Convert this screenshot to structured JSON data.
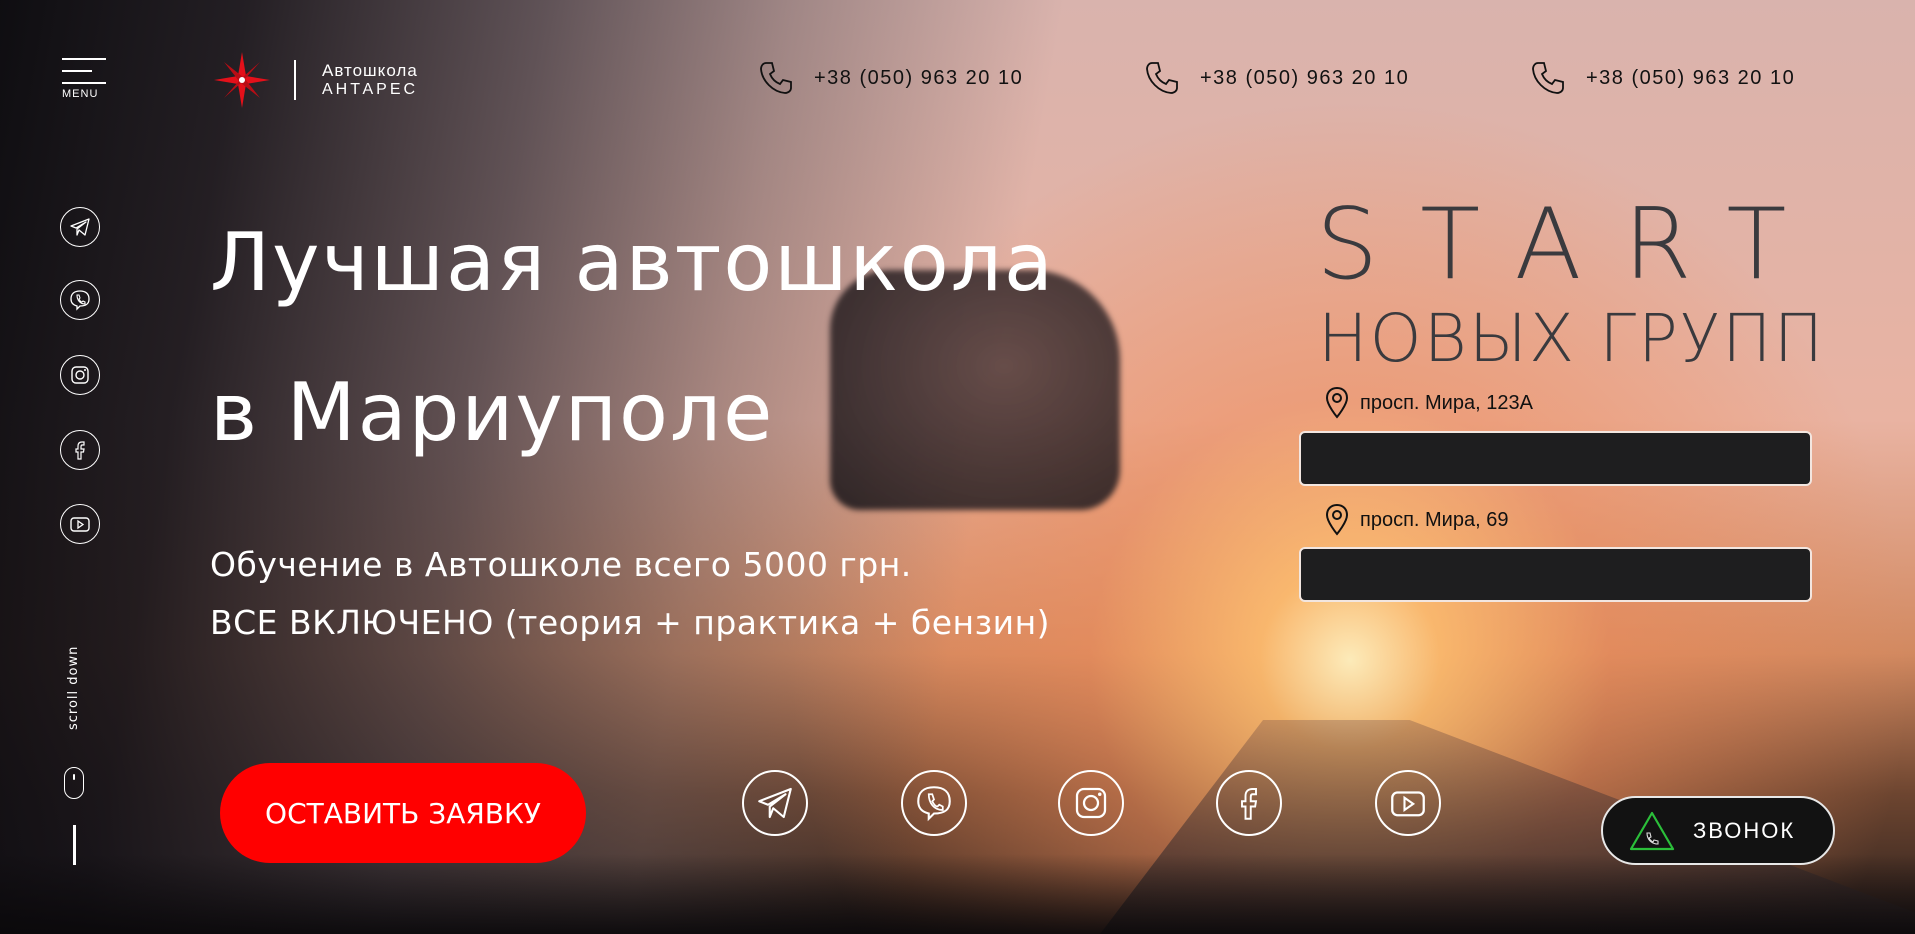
{
  "header": {
    "menu_label": "MENU",
    "logo_line1": "Автошкола",
    "logo_line2": "АНТАРЕС",
    "phones": [
      "+38 (050) 963 20 10",
      "+38 (050) 963 20 10",
      "+38 (050) 963 20 10"
    ]
  },
  "sidebar": {
    "icons": [
      "telegram-icon",
      "viber-icon",
      "instagram-icon",
      "facebook-icon",
      "youtube-icon"
    ],
    "scroll_label": "scroll down"
  },
  "hero": {
    "title_line1": "Лучшая автошкола",
    "title_line2": "в Мариуполе",
    "subtitle_line1": "Обучение в Автошколе всего 5000 грн.",
    "subtitle_line2": "ВСЕ ВКЛЮЧЕНО (теория + практика + бензин)",
    "cta_label": "ОСТАВИТЬ ЗАЯВКУ"
  },
  "promo": {
    "title": "START",
    "subtitle": "НОВЫХ ГРУПП",
    "addresses": [
      "просп. Мира, 123А",
      "просп. Мира, 69"
    ]
  },
  "bottom_social": [
    "telegram-icon",
    "viber-icon",
    "instagram-icon",
    "facebook-icon",
    "youtube-icon"
  ],
  "call_button": {
    "label": "ЗВОНОК"
  },
  "colors": {
    "accent": "#ff0000",
    "dark": "#1e1e1f",
    "title_gray": "#3a3a3e"
  }
}
